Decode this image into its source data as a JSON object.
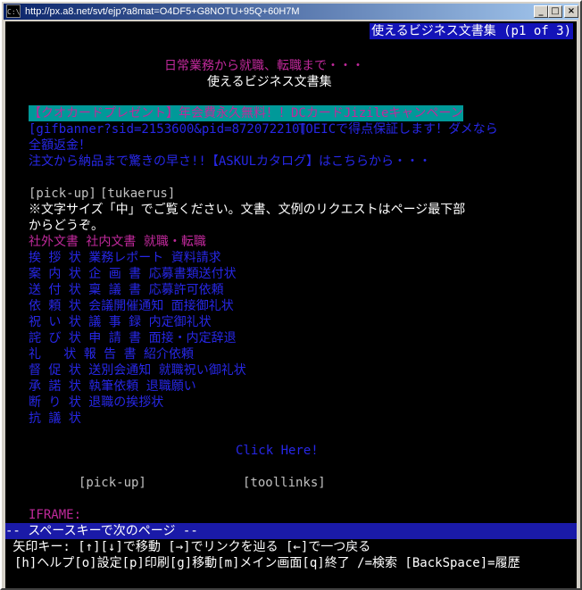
{
  "window": {
    "title": "http://px.a8.net/svt/ejp?a8mat=O4DF5+G8NOTU+95Q+60H7M",
    "icon_label": "C:\\"
  },
  "page": {
    "header": "使えるビジネス文書集 (p1 of 3)",
    "subtitle_pink": "日常業務から就職、転職まで・・・",
    "subtitle_white": "使えるビジネス文書集",
    "ad_banner": "【クオカードプレゼント】年会費永久無料！！DCカードJizileキャンペーン",
    "ad_gif": "[gifbanner?sid=2153600&pid=872072210]",
    "ad_toeic": "TOEICで得点保証します！ダメなら",
    "ad_refund": "全額返金！",
    "ad_askul": "注文から納品まで驚きの早さ!!【ASKULカタログ】はこちらから・・・",
    "nav_pickup": "[pick-up]",
    "nav_tukaerus": "[tukaerus]",
    "note_line1": "※文字サイズ「中」でご覧ください。文書、文例のリクエストはページ最下部",
    "note_line2": "からどうぞ。",
    "categories": "社外文書 社内文書 就職・転職",
    "doc_rows": [
      "挨 拶 状 業務レポート 資料請求",
      "案 内 状 企 画 書 応募書類送付状",
      "送 付 状 稟 議 書 応募許可依頼",
      "依 頼 状 会議開催通知 面接御礼状",
      "祝 い 状 議 事 録 内定御礼状",
      "詫 び 状 申 請 書 面接・内定辞退",
      "礼   状 報 告 書 紹介依頼",
      "督 促 状 送別会通知 就職祝い御礼状",
      "承 諾 状 執筆依頼 退職願い",
      "断 り 状 退職の挨拶状",
      "抗 議 状"
    ],
    "click_here": "Click Here!",
    "footer_pickup": "[pick-up]",
    "footer_toollinks": "[toollinks]",
    "iframe_label": "IFRAME:"
  },
  "status": {
    "line": "-- スペースキーで次のページ --",
    "help1": " 矢印キー: [↑][↓]で移動 [→]でリンクを辿る [←]で一つ戻る",
    "help2": "[h]ヘルプ[o]設定[p]印刷[g]移動[m]メイン画面[q]終了 /=検索 [BackSpace]=履歴"
  }
}
